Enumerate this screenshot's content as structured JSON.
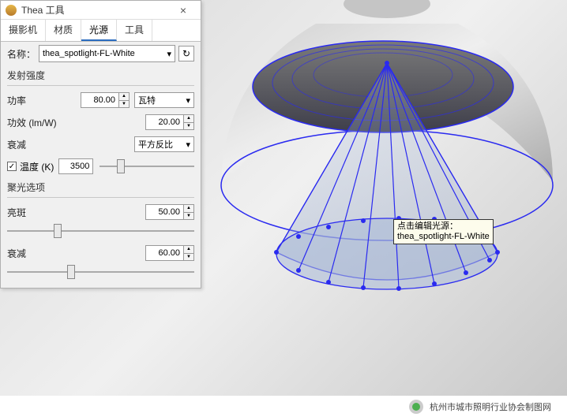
{
  "window": {
    "title": "Thea 工具",
    "close": "×"
  },
  "tabs": {
    "camera": "摄影机",
    "material": "材质",
    "light": "光源",
    "tool": "工具"
  },
  "name": {
    "label": "名称：",
    "value": "thea_spotlight-FL-White"
  },
  "emission": {
    "group": "发射强度",
    "power_label": "功率",
    "power_value": "80.00",
    "power_unit": "瓦特",
    "efficacy_label": "功效 (lm/W)",
    "efficacy_value": "20.00",
    "decay_label": "衰减",
    "decay_value": "平方反比",
    "temp_label": "温度 (K)",
    "temp_value": "3500"
  },
  "spot": {
    "group": "聚光选项",
    "bright_label": "亮斑",
    "bright_value": "50.00",
    "falloff_label": "衰减",
    "falloff_value": "60.00"
  },
  "tooltip": {
    "line1": "点击编辑光源：",
    "line2": "thea_spotlight-FL-White"
  },
  "footer": {
    "text": "杭州市城市照明行业协会制图网"
  }
}
